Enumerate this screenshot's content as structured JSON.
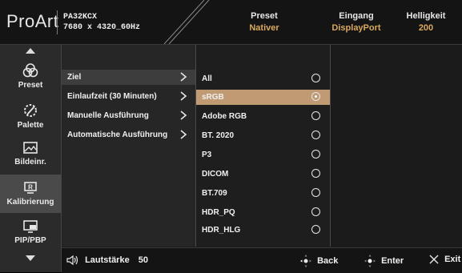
{
  "header": {
    "logo": "ProArt",
    "model": "PA32KCX",
    "resolution": "7680 x 4320_60Hz",
    "stats": [
      {
        "label": "Preset",
        "value": "Nativer"
      },
      {
        "label": "Eingang",
        "value": "DisplayPort"
      },
      {
        "label": "Helligkeit",
        "value": "200"
      }
    ]
  },
  "nav": {
    "items": [
      {
        "label": "Preset",
        "icon": "palette-icon"
      },
      {
        "label": "Palette",
        "icon": "color-wheel-icon"
      },
      {
        "label": "Bildeinr.",
        "icon": "image-icon"
      },
      {
        "label": "Kalibrierung",
        "icon": "calibration-icon"
      },
      {
        "label": "PIP/PBP",
        "icon": "pip-icon"
      }
    ],
    "active_index": 3
  },
  "submenu": {
    "items": [
      {
        "label": "Ziel"
      },
      {
        "label": "Einlaufzeit (30 Minuten)"
      },
      {
        "label": "Manuelle Ausführung"
      },
      {
        "label": "Automatische Ausführung"
      }
    ],
    "active_index": 0
  },
  "options": {
    "items": [
      {
        "label": "All"
      },
      {
        "label": "sRGB"
      },
      {
        "label": "Adobe RGB"
      },
      {
        "label": "BT. 2020"
      },
      {
        "label": "P3"
      },
      {
        "label": "DICOM"
      },
      {
        "label": "BT.709"
      },
      {
        "label": "HDR_PQ"
      },
      {
        "label": "HDR_HLG"
      }
    ],
    "selected_index": 1,
    "selected_color": "#c09a72"
  },
  "footer": {
    "volume_label": "Lautstärke",
    "volume_value": "50",
    "back_label": "Back",
    "enter_label": "Enter",
    "exit_label": "Exit"
  },
  "colors": {
    "accent": "#d9a95e",
    "background": "#1b1b1b"
  }
}
